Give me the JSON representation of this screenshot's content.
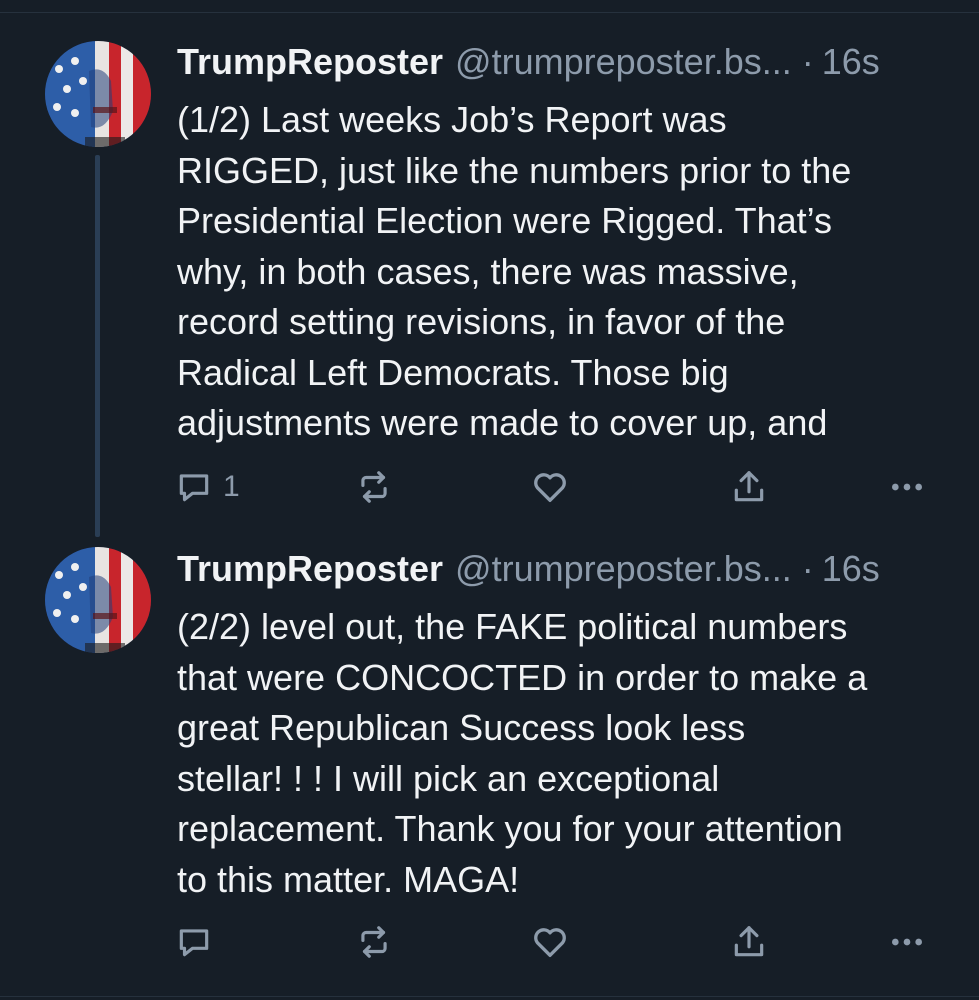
{
  "posts": [
    {
      "display_name": "TrumpReposter",
      "handle": "@trumpreposter.bs...",
      "separator": "·",
      "time": "16s",
      "text": "(1/2) Last weeks Job’s Report was\nRIGGED, just like the numbers prior to the\nPresidential Election were Rigged. That’s\nwhy, in both cases, there was massive,\nrecord setting revisions, in favor of the\nRadical Left Democrats. Those big\nadjustments were made to cover up, and",
      "reply_count": "1",
      "avatar": "flag-painted-face"
    },
    {
      "display_name": "TrumpReposter",
      "handle": "@trumpreposter.bs...",
      "separator": "·",
      "time": "16s",
      "text": "(2/2) level out, the FAKE political numbers\nthat were CONCOCTED in order to make a\ngreat Republican Success look less\nstellar! ! ! I will pick an exceptional\nreplacement. Thank you for your attention\nto this matter. MAGA!",
      "reply_count": "",
      "avatar": "flag-painted-face"
    }
  ],
  "icons": {
    "reply": "reply-icon",
    "repost": "repost-icon",
    "like": "heart-icon",
    "share": "share-icon",
    "more": "more-icon"
  },
  "colors": {
    "background": "#161e27",
    "text": "#f1f3f5",
    "muted": "#8d9bab",
    "thread_line": "#2a3e55"
  }
}
